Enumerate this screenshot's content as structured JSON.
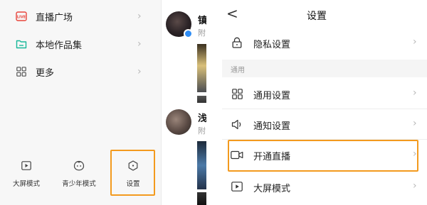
{
  "drawer": {
    "items": [
      {
        "label": "直播广场",
        "icon": "live-icon"
      },
      {
        "label": "本地作品集",
        "icon": "folder-icon"
      },
      {
        "label": "更多",
        "icon": "grid-icon"
      }
    ],
    "bottom": [
      {
        "label": "大屏模式",
        "icon": "big-screen-icon"
      },
      {
        "label": "青少年模式",
        "icon": "teen-mode-icon"
      },
      {
        "label": "设置",
        "icon": "settings-icon"
      }
    ]
  },
  "feed": {
    "user1": {
      "name_fragment": "镇",
      "sub_fragment": "附"
    },
    "user2": {
      "name_fragment": "浅",
      "sub_fragment": "附"
    }
  },
  "settings": {
    "title": "设置",
    "rows": [
      {
        "label": "隐私设置",
        "icon": "lock-icon"
      },
      {
        "label": "通用设置",
        "icon": "grid-icon"
      },
      {
        "label": "通知设置",
        "icon": "speaker-icon"
      },
      {
        "label": "开通直播",
        "icon": "video-camera-icon"
      },
      {
        "label": "大屏模式",
        "icon": "play-screen-icon"
      }
    ],
    "section_label": "通用"
  },
  "colors": {
    "highlight": "#f39a1e",
    "live_red": "#e8453c",
    "folder_teal": "#18b89a"
  }
}
